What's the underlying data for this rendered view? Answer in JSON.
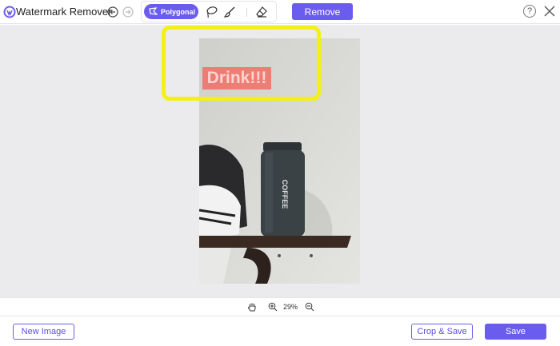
{
  "app": {
    "title": "Watermark Remover",
    "accent_color": "#6b5cf0",
    "highlight_color": "#f4f013"
  },
  "toolbar": {
    "undo_icon": "undo-icon",
    "redo_icon": "redo-icon",
    "tools": [
      {
        "label": "Polygonal",
        "icon": "polygonal-icon",
        "selected": true
      },
      {
        "label": "",
        "icon": "lasso-icon",
        "selected": false
      },
      {
        "label": "",
        "icon": "brush-icon",
        "selected": false
      },
      {
        "label": "",
        "icon": "eraser-icon",
        "selected": false
      }
    ],
    "remove_label": "Remove",
    "help_label": "?",
    "close_icon": "close-icon"
  },
  "image": {
    "watermark_text": "Drink!!!",
    "cup_label": "COFFEE"
  },
  "zoom": {
    "level": "29%",
    "hand_icon": "hand-icon",
    "zoom_in_icon": "zoom-in-icon",
    "zoom_out_icon": "zoom-out-icon"
  },
  "footer": {
    "new_image_label": "New Image",
    "crop_save_label": "Crop & Save",
    "save_label": "Save"
  }
}
